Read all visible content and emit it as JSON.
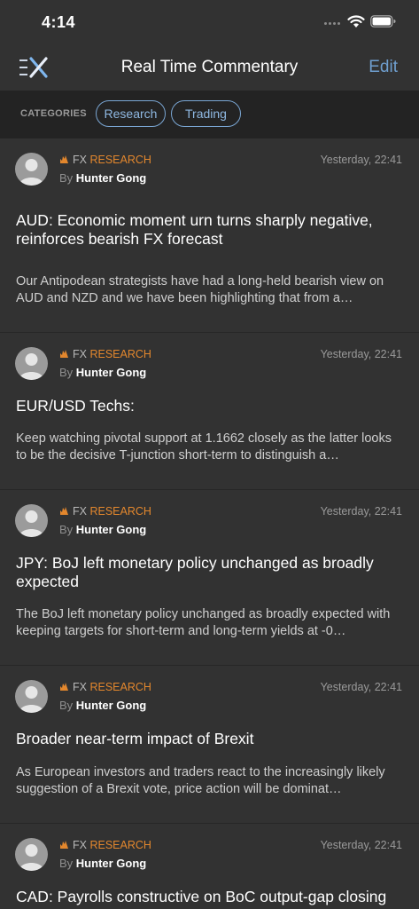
{
  "status_bar": {
    "time": "4:14"
  },
  "nav": {
    "title": "Real Time Commentary",
    "edit_label": "Edit"
  },
  "categories": {
    "label": "CATEGORIES",
    "chips": [
      "Research",
      "Trading"
    ],
    "accent_color": "#7aa6d3"
  },
  "colors": {
    "background": "#323232",
    "research_orange": "#e3872d",
    "link_blue": "#6f9fcf"
  },
  "articles": [
    {
      "category_prefix": "FX",
      "category": "RESEARCH",
      "by": "By",
      "author": "Hunter Gong",
      "date": "Yesterday, 22:41",
      "headline": "AUD: Economic moment urn turns sharply negative, reinforces bearish FX forecast",
      "summary": "Our Antipodean strategists have had a long-held bearish view on AUD and NZD and we have been highlighting that from a…"
    },
    {
      "category_prefix": "FX",
      "category": "RESEARCH",
      "by": "By",
      "author": "Hunter Gong",
      "date": "Yesterday, 22:41",
      "headline": "EUR/USD Techs:",
      "summary": "Keep watching pivotal support at 1.1662 closely as the latter looks to be the decisive T-junction short-term to distinguish a…"
    },
    {
      "category_prefix": "FX",
      "category": "RESEARCH",
      "by": "By",
      "author": "Hunter Gong",
      "date": "Yesterday, 22:41",
      "headline": "JPY: BoJ left monetary policy unchanged as broadly expected",
      "summary": "The BoJ left monetary policy unchanged as broadly expected with keeping targets for short-term and long-term yields at -0…"
    },
    {
      "category_prefix": "FX",
      "category": "RESEARCH",
      "by": "By",
      "author": "Hunter Gong",
      "date": "Yesterday, 22:41",
      "headline": "Broader near-term impact of Brexit",
      "summary": "As European investors and traders react to the increasingly likely suggestion of a Brexit vote, price action will be dominat…"
    },
    {
      "category_prefix": "FX",
      "category": "RESEARCH",
      "by": "By",
      "author": "Hunter Gong",
      "date": "Yesterday, 22:41",
      "headline": "CAD: Payrolls constructive on BoC output-gap closing projections",
      "summary": ""
    }
  ]
}
